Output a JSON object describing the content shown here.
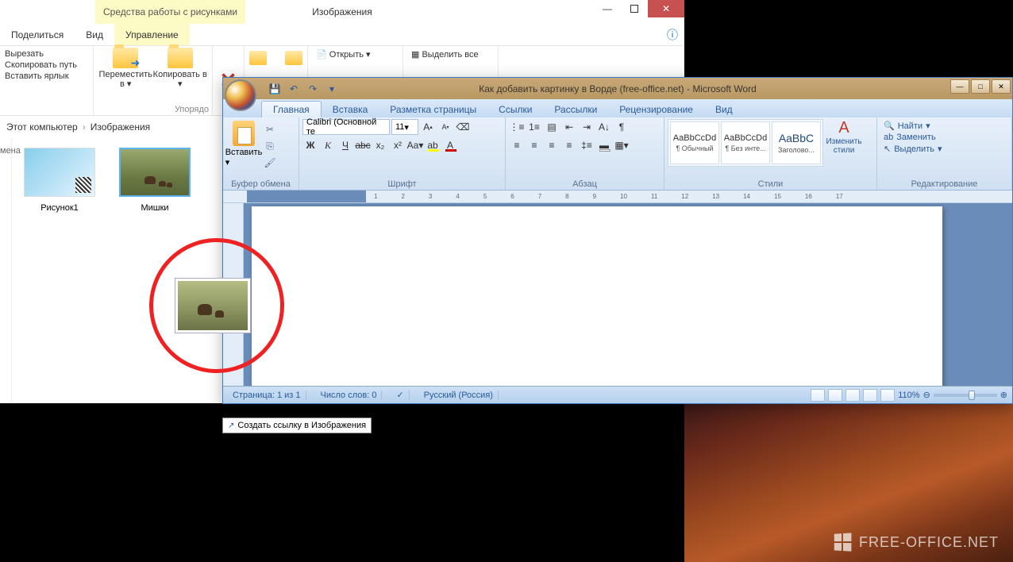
{
  "explorer": {
    "contextual_tab_label": "Средства работы с рисунками",
    "title": "Изображения",
    "tabs": {
      "share": "Поделиться",
      "view": "Вид",
      "manage": "Управление"
    },
    "ribbon": {
      "cut": "Вырезать",
      "copy_path": "Скопировать путь",
      "paste_shortcut": "Вставить ярлык",
      "move_to": "Переместить в",
      "copy_to": "Копировать в",
      "organize_group": "Упорядо",
      "open": "Открыть",
      "select_all": "Выделить все"
    },
    "breadcrumb": {
      "root": "Этот компьютер",
      "folder": "Изображения"
    },
    "sidebar_label": "мена",
    "files": [
      {
        "name": "Рисунок1"
      },
      {
        "name": "Мишки"
      }
    ]
  },
  "word": {
    "title": "Как добавить картинку в Ворде (free-office.net) - Microsoft Word",
    "tabs": {
      "home": "Главная",
      "insert": "Вставка",
      "layout": "Разметка страницы",
      "references": "Ссылки",
      "mailings": "Рассылки",
      "review": "Рецензирование",
      "view": "Вид"
    },
    "clipboard": {
      "paste": "Вставить",
      "group": "Буфер обмена"
    },
    "font": {
      "name": "Calibri (Основной те",
      "size": "11",
      "group": "Шрифт"
    },
    "paragraph": {
      "group": "Абзац"
    },
    "styles": {
      "preview": "AaBbCcDd",
      "preview_heading": "AaBbC",
      "normal": "¶ Обычный",
      "nospacing": "¶ Без инте...",
      "heading1": "Заголово...",
      "change": "Изменить стили",
      "group": "Стили"
    },
    "editing": {
      "find": "Найти",
      "replace": "Заменить",
      "select": "Выделить",
      "group": "Редактирование"
    },
    "status": {
      "page": "Страница: 1 из 1",
      "words": "Число слов: 0",
      "language": "Русский (Россия)",
      "zoom": "110%"
    }
  },
  "drag_tooltip": "Создать ссылку в Изображения",
  "watermark": "FREE-OFFICE.NET"
}
